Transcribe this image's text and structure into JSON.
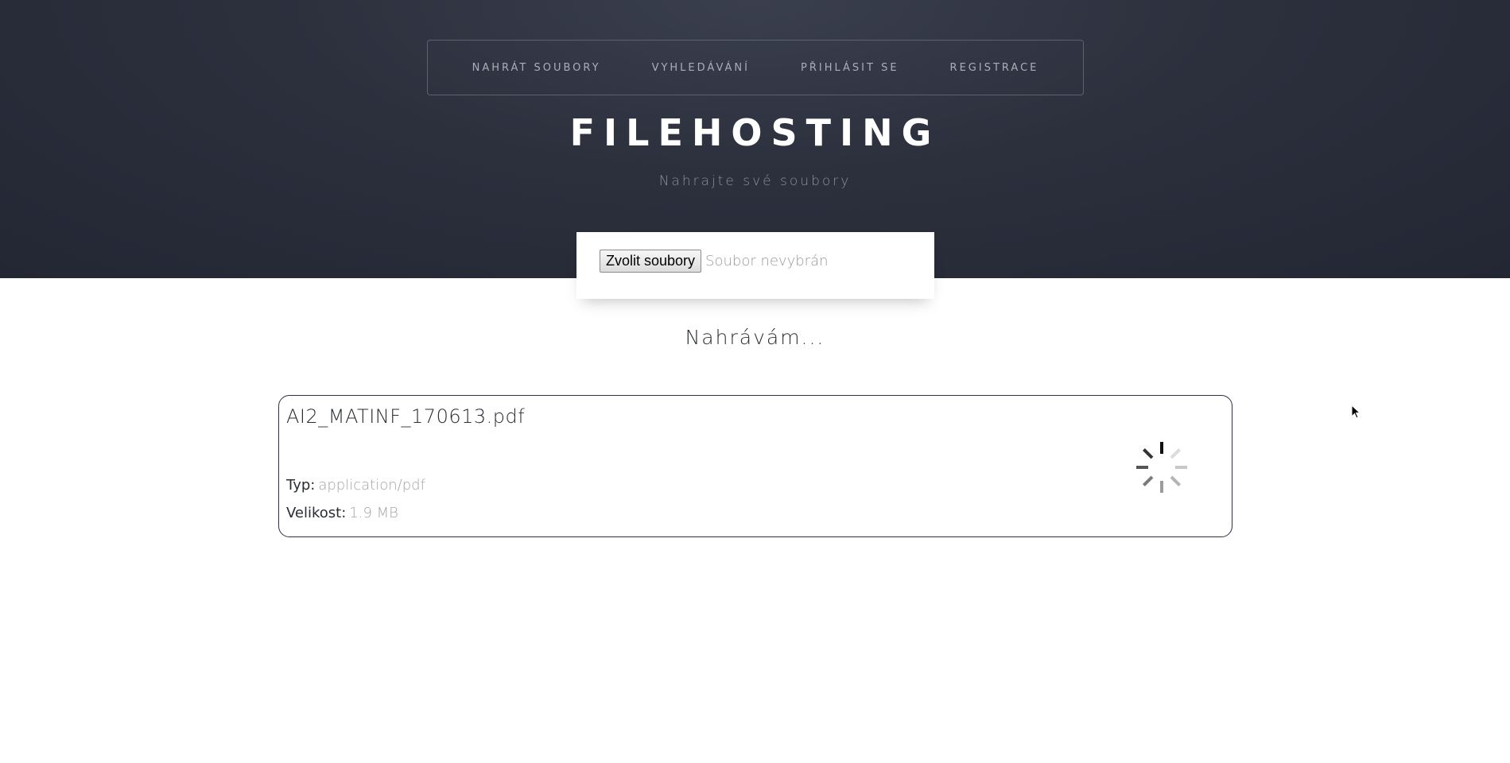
{
  "nav": {
    "items": [
      {
        "label": "NAHRÁT SOUBORY"
      },
      {
        "label": "VYHLEDÁVÁNÍ"
      },
      {
        "label": "PŘIHLÁSIT SE"
      },
      {
        "label": "REGISTRACE"
      }
    ]
  },
  "header": {
    "title": "FILEHOSTING",
    "subtitle": "Nahrajte své soubory"
  },
  "upload": {
    "button_label": "Zvolit soubory",
    "status": "Soubor nevybrán"
  },
  "progress": {
    "message": "Nahrávám..."
  },
  "file": {
    "name": "AI2_MATINF_170613.pdf",
    "type_label": "Typ:",
    "type_value": "application/pdf",
    "size_label": "Velikost:",
    "size_value": "1.9 MB"
  },
  "icons": {
    "spinner": "loading-spinner-icon",
    "cursor": "mouse-pointer-icon"
  }
}
